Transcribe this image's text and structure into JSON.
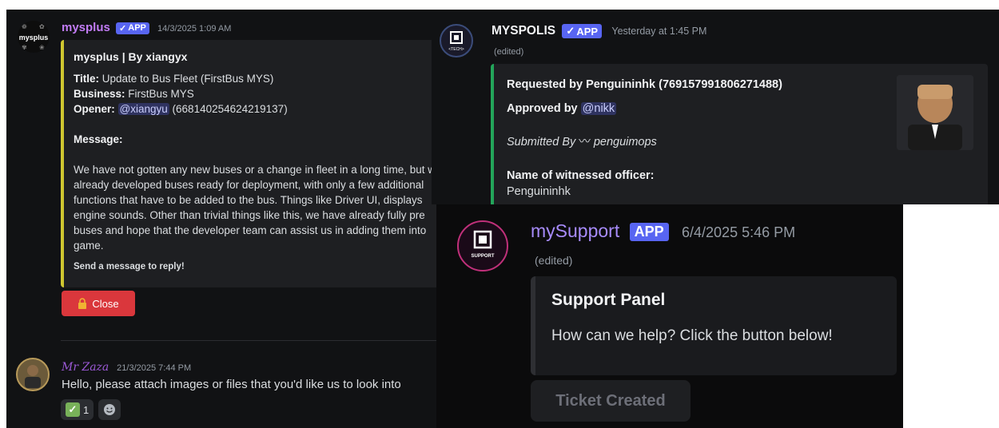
{
  "messages": {
    "mysplus": {
      "username": "mysplus",
      "avatar_label": "mysplus",
      "badge": "APP",
      "timestamp": "14/3/2025 1:09 AM",
      "embed": {
        "title": "mysplus | By xiangyx",
        "title_label": "Title:",
        "title_value": "Update to Bus Fleet (FirstBus MYS)",
        "business_label": "Business:",
        "business_value": "FirstBus MYS",
        "opener_label": "Opener:",
        "opener_mention": "@xiangyu",
        "opener_id": "(668140254624219137)",
        "message_label": "Message:",
        "message_lines": [
          "We have not gotten any new buses or a change in fleet in a long time, but w",
          "already developed buses ready for deployment, with only a few additional",
          "functions that have to be added to the bus. Things like Driver UI, displays",
          "engine sounds. Other than trivial things like this, we have already fully pre",
          "buses and hope that the developer team can assist us in adding them into",
          "game."
        ],
        "footer": "Send a message to reply!",
        "accent_color": "#cfc630"
      },
      "button_label": "Close",
      "button_color": "#da373c",
      "button_icon": "lock-icon"
    },
    "mrzaza": {
      "username": "Mr Zaza",
      "timestamp": "21/3/2025 7:44 PM",
      "text": "Hello, please attach images or files that you'd like us to look into",
      "reactions": [
        {
          "emoji": "white-check-mark",
          "count": "1"
        },
        {
          "emoji": "add-reaction-icon",
          "count": ""
        }
      ]
    },
    "myspolis": {
      "username": "MYSPOLIS",
      "badge": "APP",
      "timestamp": "Yesterday at 1:45 PM",
      "edited": "(edited)",
      "avatar_label": "<TECH>",
      "embed": {
        "requested": "Requested by Penguininhk (769157991806271488)",
        "approved_label": "Approved by",
        "approved_mention": "@nikk",
        "submitted": "Submitted By",
        "submitted_name": "penguimops",
        "officer_label": "Name of witnessed officer:",
        "officer_value": "Penguininhk",
        "accent_color": "#23a55a"
      }
    },
    "mysupport": {
      "username": "mySupport",
      "badge": "APP",
      "timestamp": "6/4/2025 5:46 PM",
      "edited": "(edited)",
      "avatar_label": "SUPPORT",
      "embed": {
        "title": "Support Panel",
        "description": "How can we help? Click the button below!"
      },
      "button_label": "Ticket Created"
    }
  }
}
